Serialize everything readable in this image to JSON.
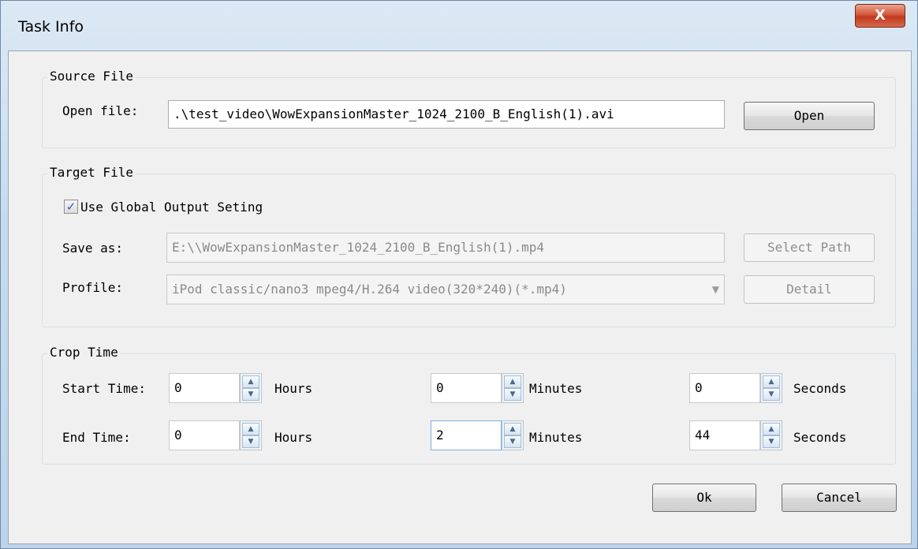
{
  "window": {
    "title": "Task Info",
    "close_glyph": "X"
  },
  "source": {
    "legend": "Source File",
    "open_label": "Open file:",
    "file_path": ".\\test_video\\WowExpansionMaster_1024_2100_B_English(1).avi",
    "open_button": "Open"
  },
  "target": {
    "legend": "Target File",
    "use_global_label": "Use Global Output Seting",
    "use_global_checked": true,
    "save_as_label": "Save as:",
    "save_as_value": "E:\\\\WowExpansionMaster_1024_2100_B_English(1).mp4",
    "select_path_button": "Select Path",
    "profile_label": "Profile:",
    "profile_value": "iPod classic/nano3 mpeg4/H.264 video(320*240)(*.mp4)",
    "detail_button": "Detail"
  },
  "crop": {
    "legend": "Crop Time",
    "start_label": "Start Time:",
    "end_label": "End Time:",
    "start": {
      "hours": "0",
      "minutes": "0",
      "seconds": "0"
    },
    "end": {
      "hours": "0",
      "minutes": "2",
      "seconds": "44"
    },
    "hours_unit": "Hours",
    "minutes_unit": "Minutes",
    "seconds_unit": "Seconds"
  },
  "footer": {
    "ok_button": "Ok",
    "cancel_button": "Cancel"
  },
  "colors": {
    "accent_check": "#2a55c9",
    "close_red": "#c0391c"
  },
  "icons": {
    "check": "check-icon",
    "spin_up": "spin-up-icon",
    "spin_down": "spin-down-icon",
    "close": "close-icon",
    "dropdown": "chevron-down-icon"
  }
}
